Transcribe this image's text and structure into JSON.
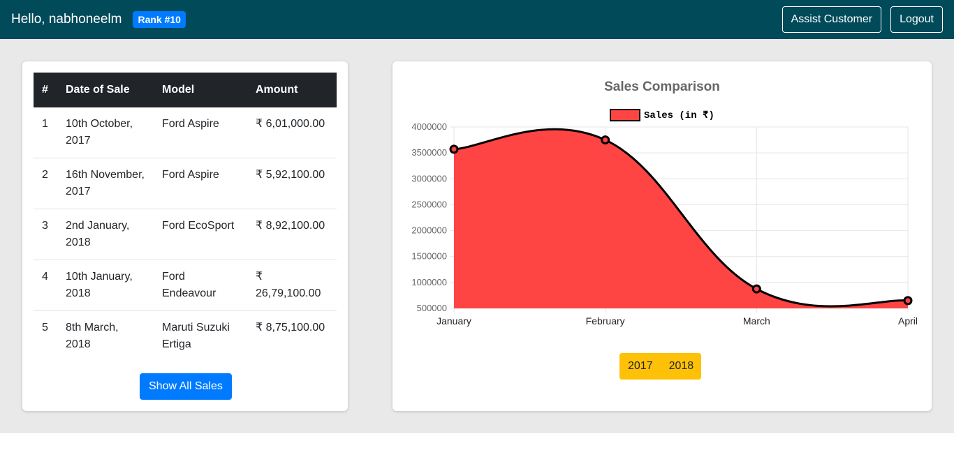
{
  "header": {
    "greeting": "Hello, nabhoneelm",
    "rank": "Rank #10",
    "assist_label": "Assist Customer",
    "logout_label": "Logout"
  },
  "sales_table": {
    "columns": [
      "#",
      "Date of Sale",
      "Model",
      "Amount"
    ],
    "rows": [
      {
        "idx": "1",
        "date": "10th October, 2017",
        "model": "Ford Aspire",
        "amount": "₹ 6,01,000.00"
      },
      {
        "idx": "2",
        "date": "16th November, 2017",
        "model": "Ford Aspire",
        "amount": "₹ 5,92,100.00"
      },
      {
        "idx": "3",
        "date": "2nd January, 2018",
        "model": "Ford EcoSport",
        "amount": "₹ 8,92,100.00"
      },
      {
        "idx": "4",
        "date": "10th January, 2018",
        "model": "Ford Endeavour",
        "amount": "₹ 26,79,100.00"
      },
      {
        "idx": "5",
        "date": "8th March, 2018",
        "model": "Maruti Suzuki Ertiga",
        "amount": "₹ 8,75,100.00"
      }
    ],
    "show_all_label": "Show All Sales"
  },
  "chart_panel": {
    "year_buttons": [
      "2017",
      "2018"
    ]
  },
  "chart_data": {
    "type": "area",
    "title": "Sales Comparison",
    "categories": [
      "January",
      "February",
      "March",
      "April"
    ],
    "series": [
      {
        "name": "Sales (in ₹)",
        "values": [
          3571200,
          3750000,
          875100,
          650000
        ],
        "color": "#ff4444",
        "line_color": "#000000"
      }
    ],
    "ylim": [
      500000,
      4000000
    ],
    "yticks": [
      "4000000",
      "3500000",
      "3000000",
      "2500000",
      "2000000",
      "1500000",
      "1000000",
      "500000"
    ],
    "grid": true,
    "legend": "top"
  }
}
